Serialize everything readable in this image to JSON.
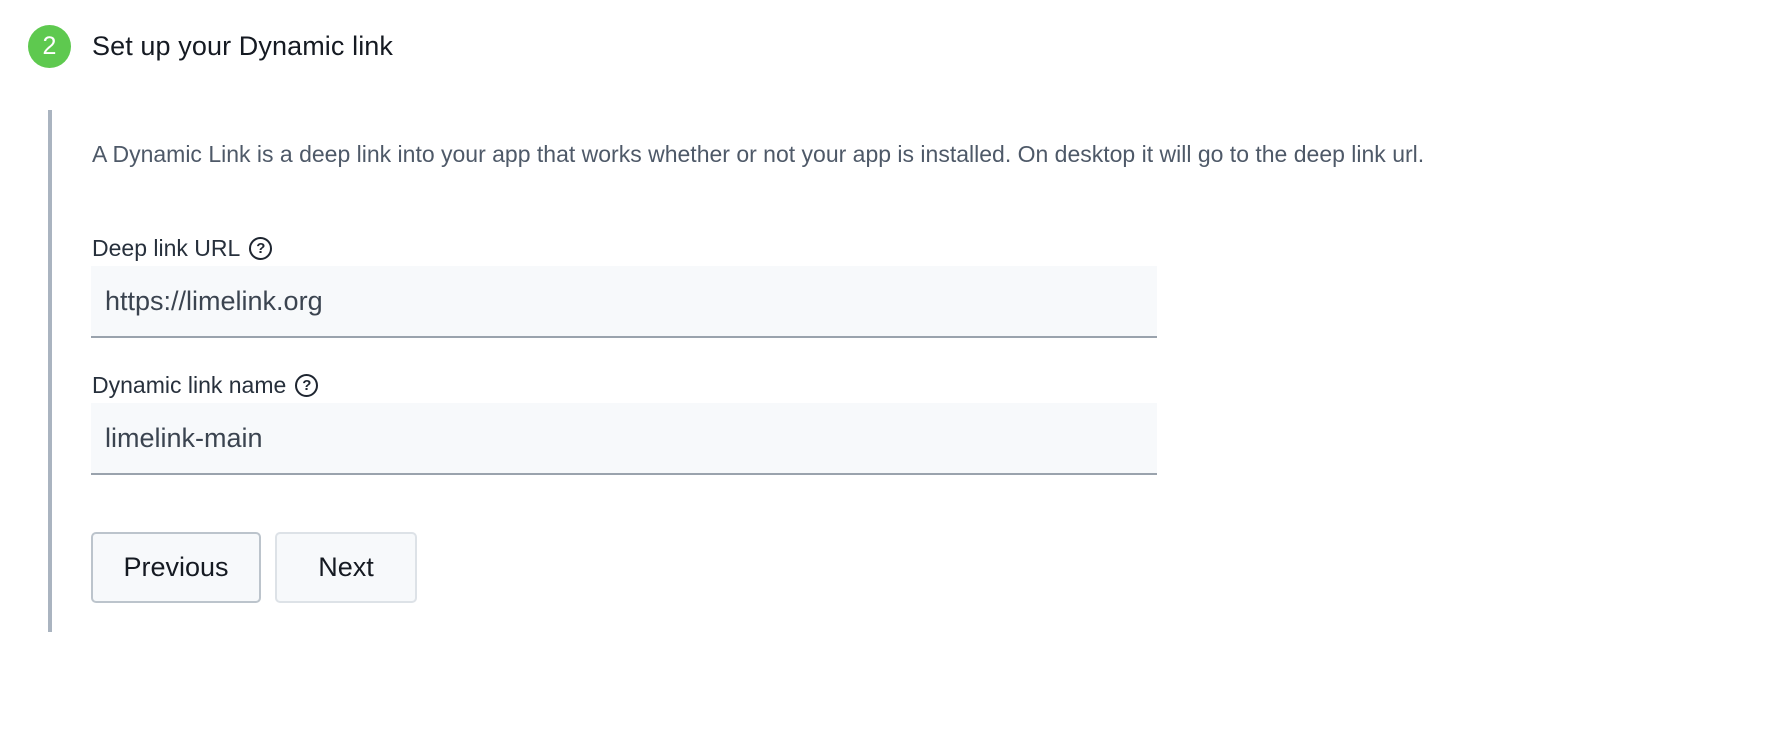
{
  "step": {
    "number": "2",
    "title": "Set up your Dynamic link",
    "badge_color": "#5ec94f"
  },
  "description": "A Dynamic Link is a deep link into your app that works whether or not your app is installed. On desktop it will go to the deep link url.",
  "fields": {
    "deep_link_url": {
      "label": "Deep link URL",
      "help_icon": "question-circle-icon",
      "value": "https://limelink.org"
    },
    "dynamic_link_name": {
      "label": "Dynamic link name",
      "help_icon": "question-circle-icon",
      "value": "limelink-main"
    }
  },
  "buttons": {
    "previous_label": "Previous",
    "next_label": "Next"
  }
}
